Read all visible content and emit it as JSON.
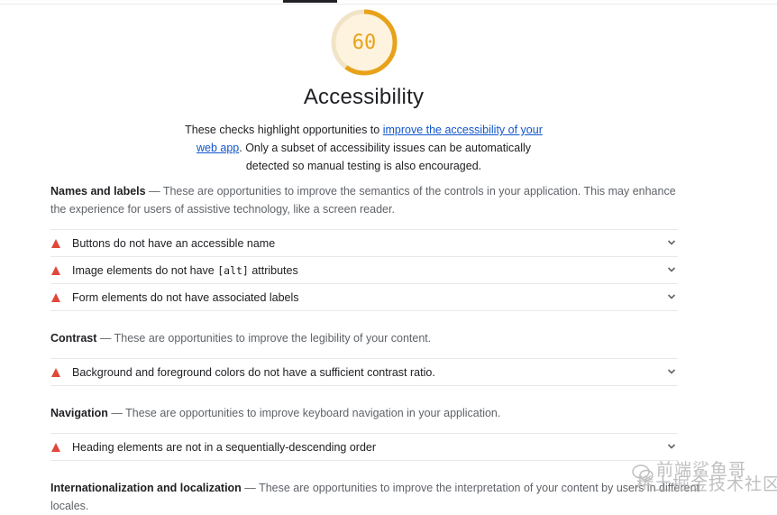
{
  "score": {
    "value": "60",
    "fraction": 0.6,
    "color": "#e8a21a"
  },
  "category": {
    "title": "Accessibility",
    "desc_prefix": "These checks highlight opportunities to ",
    "desc_link": "improve the accessibility of your web app",
    "desc_suffix": ". Only a subset of accessibility issues can be automatically detected so manual testing is also encouraged."
  },
  "groups": {
    "names": {
      "title": "Names and labels",
      "description": "These are opportunities to improve the semantics of the controls in your application. This may enhance the experience for users of assistive technology, like a screen reader.",
      "audits": [
        {
          "text": "Buttons do not have an accessible name"
        },
        {
          "pre": "Image elements do not have ",
          "code": "[alt]",
          "post": " attributes"
        },
        {
          "text": "Form elements do not have associated labels"
        }
      ]
    },
    "contrast": {
      "title": "Contrast",
      "description": "These are opportunities to improve the legibility of your content.",
      "audits": [
        {
          "text": "Background and foreground colors do not have a sufficient contrast ratio."
        }
      ]
    },
    "navigation": {
      "title": "Navigation",
      "description": "These are opportunities to improve keyboard navigation in your application.",
      "audits": [
        {
          "text": "Heading elements are not in a sequentially-descending order"
        }
      ]
    },
    "i18n": {
      "title": "Internationalization and localization",
      "description": "These are opportunities to improve the interpretation of your content by users in different locales."
    }
  },
  "separator": " — ",
  "watermark": {
    "line1": "前端鲨鱼哥",
    "line2": "稀土掘金技术社区"
  },
  "colors": {
    "fail": "#e0483a",
    "link": "#1155cc"
  }
}
